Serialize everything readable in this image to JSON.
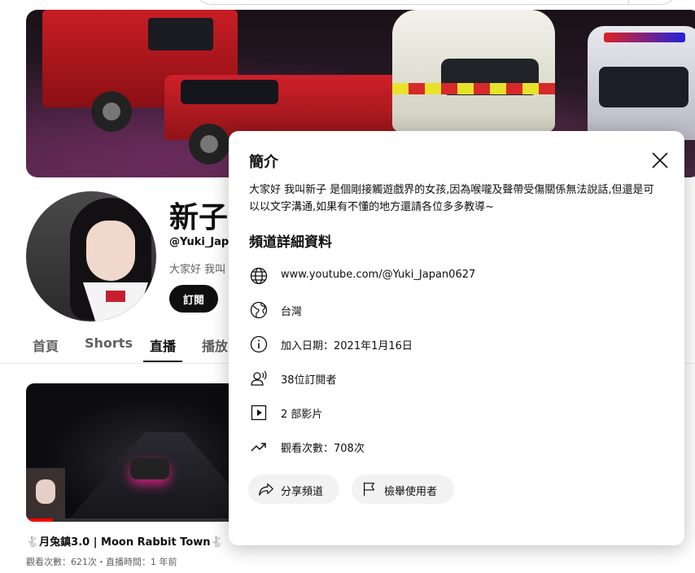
{
  "channel": {
    "name": "新子",
    "handle": "@Yuki_Japa",
    "description_preview": "大家好 我叫",
    "subscribe_label": "訂閱"
  },
  "tabs": [
    {
      "label": "首頁",
      "active": false
    },
    {
      "label": "Shorts",
      "active": false
    },
    {
      "label": "直播",
      "active": true
    },
    {
      "label": "播放",
      "active": false
    }
  ],
  "video": {
    "title": "🐇月兔鎮3.0 | Moon Rabbit Town🐇",
    "meta": "觀看次數：621次・直播時間：1 年前",
    "progress": 0.12
  },
  "about_modal": {
    "title": "簡介",
    "description": "大家好 我叫新子 是個剛接觸遊戲界的女孩,因為喉嚨及聲帶受傷關係無法說話,但還是可以以文字溝通,如果有不懂的地方還請各位多多教導~",
    "details_title": "頻道詳細資料",
    "details": [
      {
        "icon": "globe-icon",
        "text": "www.youtube.com/@Yuki_Japan0627"
      },
      {
        "icon": "earth-location-icon",
        "text": "台灣"
      },
      {
        "icon": "info-icon",
        "text": "加入日期：2021年1月16日"
      },
      {
        "icon": "subscribers-icon",
        "text": "38位訂閱者"
      },
      {
        "icon": "video-play-icon",
        "text": "2 部影片"
      },
      {
        "icon": "trending-icon",
        "text": "觀看次數：708次"
      }
    ],
    "share_label": "分享頻道",
    "report_label": "檢舉使用者"
  }
}
